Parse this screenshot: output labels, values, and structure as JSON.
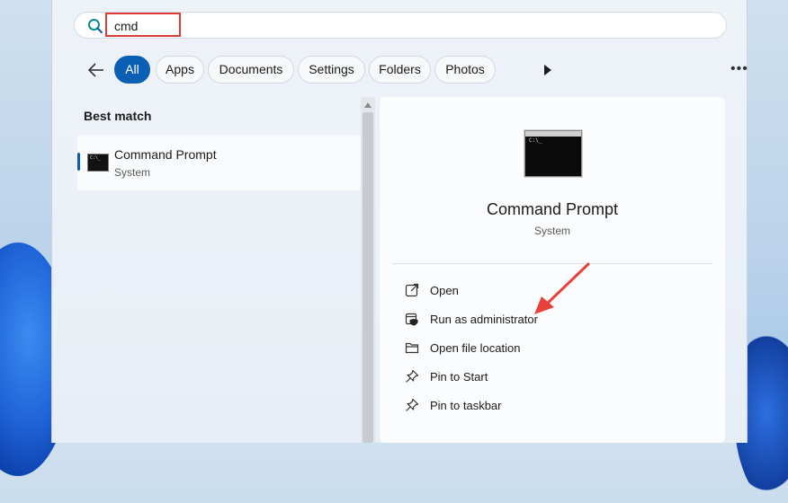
{
  "search": {
    "query": "cmd"
  },
  "filters": {
    "chips": [
      "All",
      "Apps",
      "Documents",
      "Settings",
      "Folders",
      "Photos"
    ],
    "active": "All"
  },
  "best_match": {
    "title": "Best match",
    "result": {
      "name": "Command Prompt",
      "type": "System"
    }
  },
  "detail": {
    "name": "Command Prompt",
    "type": "System",
    "actions": [
      {
        "label": "Open",
        "icon": "open-external-icon"
      },
      {
        "label": "Run as administrator",
        "icon": "shield-admin-icon"
      },
      {
        "label": "Open file location",
        "icon": "folder-icon"
      },
      {
        "label": "Pin to Start",
        "icon": "pin-icon"
      },
      {
        "label": "Pin to taskbar",
        "icon": "pin-icon"
      }
    ]
  },
  "colors": {
    "accent": "#0a5fb4",
    "highlight": "#e03b3b"
  }
}
